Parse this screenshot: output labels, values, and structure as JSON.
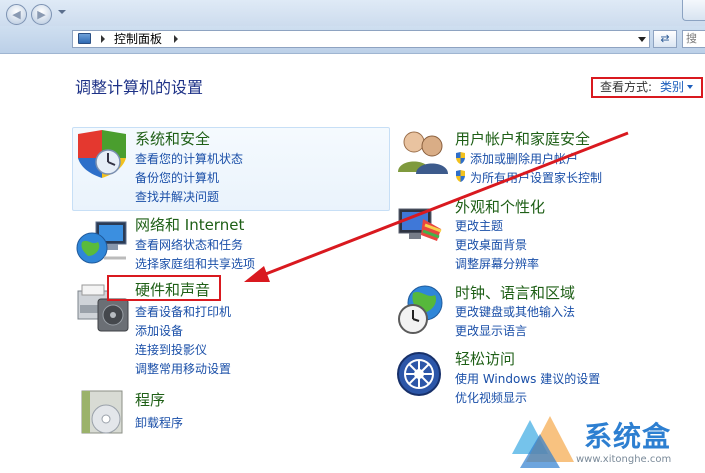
{
  "window": {
    "breadcrumb": "控制面板",
    "search_placeholder": "搜"
  },
  "main": {
    "heading": "调整计算机的设置",
    "view_by_label": "查看方式:",
    "view_by_value": "类别"
  },
  "categories": {
    "system_security": {
      "title": "系统和安全",
      "links": [
        "查看您的计算机状态",
        "备份您的计算机",
        "查找并解决问题"
      ]
    },
    "network": {
      "title": "网络和 Internet",
      "links": [
        "查看网络状态和任务",
        "选择家庭组和共享选项"
      ]
    },
    "hardware_sound": {
      "title": "硬件和声音",
      "links": [
        "查看设备和打印机",
        "添加设备",
        "连接到投影仪",
        "调整常用移动设置"
      ]
    },
    "programs": {
      "title": "程序",
      "links": [
        "卸载程序"
      ]
    },
    "user_accounts": {
      "title": "用户帐户和家庭安全",
      "links": [
        "添加或删除用户帐户",
        "为所有用户设置家长控制"
      ]
    },
    "appearance": {
      "title": "外观和个性化",
      "links": [
        "更改主题",
        "更改桌面背景",
        "调整屏幕分辨率"
      ]
    },
    "clock_region": {
      "title": "时钟、语言和区域",
      "links": [
        "更改键盘或其他输入法",
        "更改显示语言"
      ]
    },
    "ease_access": {
      "title": "轻松访问",
      "links": [
        "使用 Windows 建议的设置",
        "优化视频显示"
      ]
    }
  },
  "watermark": {
    "brand": "系统盒",
    "url": "www.xitonghe.com"
  },
  "colors": {
    "title_green": "#1e5f16",
    "link_blue": "#1a4fa8",
    "heading_blue": "#1e3287",
    "annotation_red": "#d9191f"
  },
  "icons": {
    "back": "back-arrow-icon",
    "forward": "forward-arrow-icon",
    "refresh": "refresh-icon",
    "control_panel": "control-panel-icon",
    "shield": "uac-shield-icon"
  }
}
